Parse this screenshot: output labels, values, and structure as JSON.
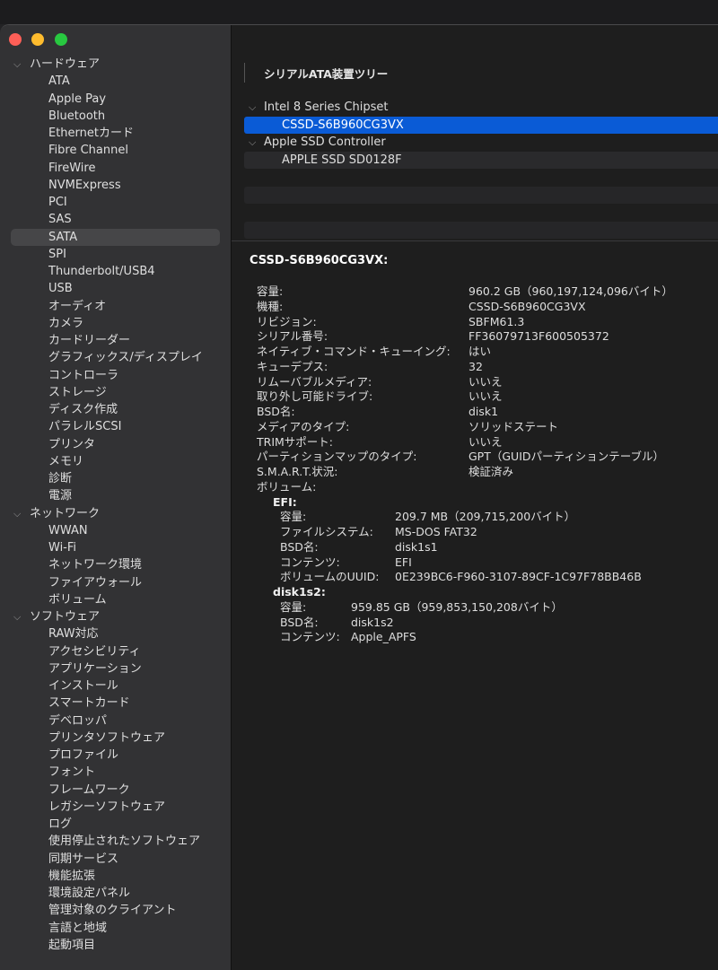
{
  "sidebar": {
    "groups": [
      {
        "label": "ハードウェア",
        "items": [
          "ATA",
          "Apple Pay",
          "Bluetooth",
          "Ethernetカード",
          "Fibre Channel",
          "FireWire",
          "NVMExpress",
          "PCI",
          "SAS",
          "SATA",
          "SPI",
          "Thunderbolt/USB4",
          "USB",
          "オーディオ",
          "カメラ",
          "カードリーダー",
          "グラフィックス/ディスプレイ",
          "コントローラ",
          "ストレージ",
          "ディスク作成",
          "パラレルSCSI",
          "プリンタ",
          "メモリ",
          "診断",
          "電源"
        ]
      },
      {
        "label": "ネットワーク",
        "items": [
          "WWAN",
          "Wi-Fi",
          "ネットワーク環境",
          "ファイアウォール",
          "ボリューム"
        ]
      },
      {
        "label": "ソフトウェア",
        "items": [
          "RAW対応",
          "アクセシビリティ",
          "アプリケーション",
          "インストール",
          "スマートカード",
          "デベロッパ",
          "プリンタソフトウェア",
          "プロファイル",
          "フォント",
          "フレームワーク",
          "レガシーソフトウェア",
          "ログ",
          "使用停止されたソフトウェア",
          "同期サービス",
          "機能拡張",
          "環境設定パネル",
          "管理対象のクライアント",
          "言語と地域",
          "起動項目"
        ]
      }
    ],
    "selected": "SATA"
  },
  "content": {
    "tree_header": "シリアルATA装置ツリー",
    "device_tree": [
      {
        "label": "Intel 8 Series Chipset",
        "type": "parent"
      },
      {
        "label": "CSSD-S6B960CG3VX",
        "type": "child",
        "selected": true
      },
      {
        "label": "Apple SSD Controller",
        "type": "parent"
      },
      {
        "label": "APPLE SSD SD0128F",
        "type": "child"
      }
    ],
    "detail_title": "CSSD-S6B960CG3VX:",
    "properties": [
      {
        "key": "容量:",
        "value": "960.2 GB（960,197,124,096バイト）",
        "level": 0
      },
      {
        "key": "機種:",
        "value": "CSSD-S6B960CG3VX",
        "level": 0
      },
      {
        "key": "リビジョン:",
        "value": "SBFM61.3",
        "level": 0
      },
      {
        "key": "シリアル番号:",
        "value": "FF36079713F600505372",
        "level": 0
      },
      {
        "key": "ネイティブ・コマンド・キューイング:",
        "value": "はい",
        "level": 0
      },
      {
        "key": "キューデプス:",
        "value": "32",
        "level": 0
      },
      {
        "key": "リムーバブルメディア:",
        "value": "いいえ",
        "level": 0
      },
      {
        "key": "取り外し可能ドライブ:",
        "value": "いいえ",
        "level": 0
      },
      {
        "key": "BSD名:",
        "value": "disk1",
        "level": 0
      },
      {
        "key": "メディアのタイプ:",
        "value": "ソリッドステート",
        "level": 0
      },
      {
        "key": "TRIMサポート:",
        "value": "いいえ",
        "level": 0
      },
      {
        "key": "パーティションマップのタイプ:",
        "value": "GPT（GUIDパーティションテーブル）",
        "level": 0
      },
      {
        "key": "S.M.A.R.T.状況:",
        "value": "検証済み",
        "level": 0
      },
      {
        "key": "ボリューム:",
        "value": "",
        "level": 0
      },
      {
        "key": "EFI:",
        "value": "",
        "level": 1,
        "bold": true
      },
      {
        "key": "容量:",
        "value": "209.7 MB（209,715,200バイト）",
        "level": 2,
        "col": "efi"
      },
      {
        "key": "ファイルシステム:",
        "value": "MS-DOS FAT32",
        "level": 2,
        "col": "efi"
      },
      {
        "key": "BSD名:",
        "value": "disk1s1",
        "level": 2,
        "col": "efi"
      },
      {
        "key": "コンテンツ:",
        "value": "EFI",
        "level": 2,
        "col": "efi"
      },
      {
        "key": "ボリュームのUUID:",
        "value": "0E239BC6-F960-3107-89CF-1C97F78BB46B",
        "level": 2,
        "col": "efi"
      },
      {
        "key": "disk1s2:",
        "value": "",
        "level": 1,
        "bold": true
      },
      {
        "key": "容量:",
        "value": "959.85 GB（959,853,150,208バイト）",
        "level": 2,
        "col": "d2"
      },
      {
        "key": "BSD名:",
        "value": "disk1s2",
        "level": 2,
        "col": "d2"
      },
      {
        "key": "コンテンツ:",
        "value": "Apple_APFS",
        "level": 2,
        "col": "d2"
      }
    ]
  }
}
